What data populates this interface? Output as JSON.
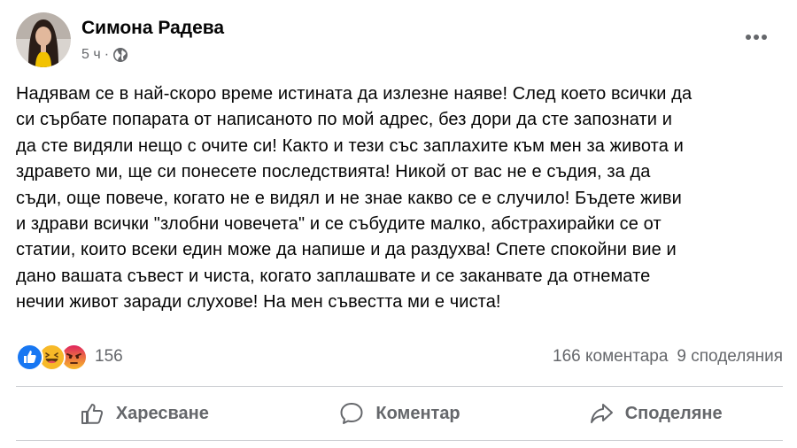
{
  "post": {
    "author": "Симона Радева",
    "time": "5 ч",
    "separator": "·",
    "text": "Надявам се в най-скоро време истината да излезне наяве! След което всички да\nси сърбате попарата от написаното по мой адрес, без дори да сте запознати и\nда сте видяли нещо с очите си! Както и тези със заплахите към мен за живота и\nздравето ми, ще си понесете последствията! Никой от вас не е съдия, за да\nсъди, още повече, когато не е видял и не знае какво се е случило! Бъдете живи\nи здрави всички \"злобни човечета\" и се събудите малко, абстрахирайки се от\nстатии, които всеки един може да напише и да раздухва! Спете спокойни вие и\nдано вашата съвест и чиста, когато заплашвате и се заканвате да отнемате\nнечии живот заради слухове! На мен съвестта ми е чиста!"
  },
  "stats": {
    "reaction_count": "156",
    "comments": "166 коментара",
    "shares": "9 споделяния",
    "reactions": [
      "like-icon",
      "haha-icon",
      "angry-icon"
    ]
  },
  "actions": {
    "like": "Харесване",
    "comment": "Коментар",
    "share": "Споделяне"
  },
  "colors": {
    "like_blue": "#1877f2",
    "haha_yellow": "#f7b928",
    "angry_orange": "#e9710f",
    "secondary_text": "#65676b"
  }
}
